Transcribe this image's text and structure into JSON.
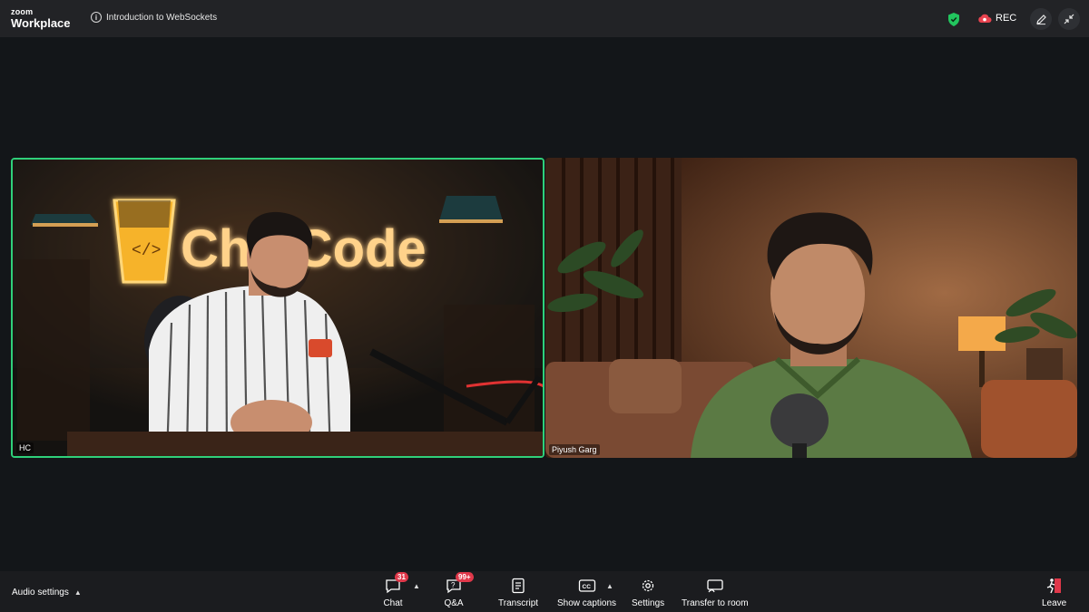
{
  "app": {
    "brand_top": "zoom",
    "brand_product": "Workplace"
  },
  "meeting": {
    "title": "Introduction to WebSockets"
  },
  "recording": {
    "label": "REC"
  },
  "participants": [
    {
      "name": "HC",
      "active_speaker": true,
      "sign_text": "ChaiCode"
    },
    {
      "name": "Piyush Garg",
      "active_speaker": false
    }
  ],
  "toolbar": {
    "audio_settings": "Audio settings",
    "items": [
      {
        "label": "Chat",
        "badge": "31",
        "icon": "chat-icon"
      },
      {
        "label": "Q&A",
        "badge": "99+",
        "icon": "qa-icon"
      },
      {
        "label": "Transcript",
        "icon": "transcript-icon"
      },
      {
        "label": "Show captions",
        "icon": "captions-icon"
      },
      {
        "label": "Settings",
        "icon": "settings-icon"
      },
      {
        "label": "Transfer to room",
        "icon": "transfer-icon"
      },
      {
        "label": "Leave",
        "icon": "leave-icon"
      }
    ]
  },
  "colors": {
    "active_border": "#2fd07a",
    "badge": "#e0384a",
    "shield": "#22c55e",
    "rec_cloud": "#e8434f"
  }
}
